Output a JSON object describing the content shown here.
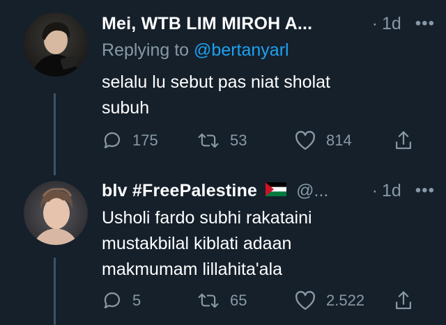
{
  "tweets": [
    {
      "name": "Mei, WTB LIM MIROH A...",
      "handle": "",
      "time": "1d",
      "replying_prefix": "Replying to",
      "replying_to": "@bertanyarl",
      "text_lines": [
        "selalu lu sebut pas niat sholat",
        "subuh"
      ],
      "replies": "175",
      "retweets": "53",
      "likes": "814"
    },
    {
      "name": "blv #FreePalestine",
      "flag": "palestine-flag",
      "handle": "@...",
      "time": "1d",
      "text_lines": [
        "Usholi fardo subhi rakataini",
        "mustakbilal kiblati adaan",
        "makmumam lillahita'ala"
      ],
      "replies": "5",
      "retweets": "65",
      "likes": "2.522"
    }
  ],
  "symbols": {
    "dot": "·",
    "more": "•••"
  },
  "colors": {
    "background": "#15202b",
    "secondary": "#8899a6",
    "link": "#1da1f2",
    "thread": "#3d5466"
  }
}
